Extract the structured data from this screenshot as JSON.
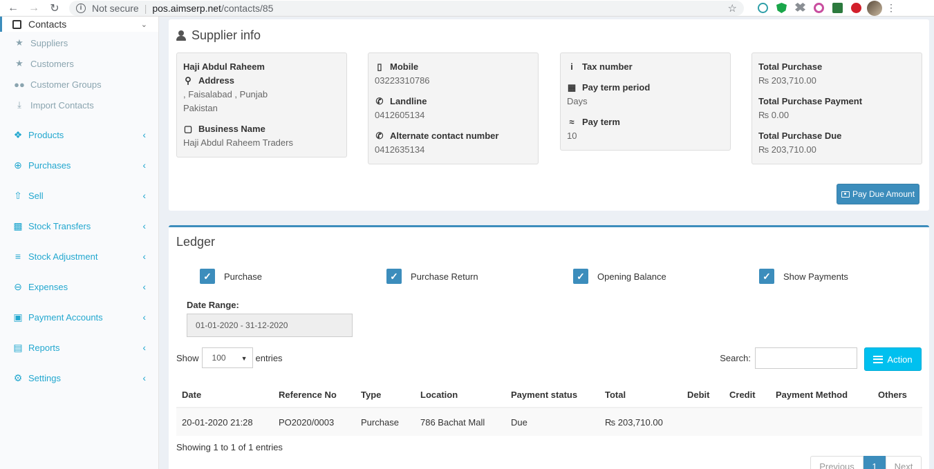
{
  "browser": {
    "security": "Not secure",
    "url_host": "pos.aimserp.net",
    "url_path": "/contacts/85"
  },
  "sidebar": {
    "header": "Contacts",
    "sub_items": [
      {
        "label": "Suppliers",
        "icon": "star-icon"
      },
      {
        "label": "Customers",
        "icon": "star-icon"
      },
      {
        "label": "Customer Groups",
        "icon": "users-icon"
      },
      {
        "label": "Import Contacts",
        "icon": "download-icon"
      }
    ],
    "items": [
      {
        "label": "Products",
        "icon": "cubes-icon"
      },
      {
        "label": "Purchases",
        "icon": "plus-circle-icon"
      },
      {
        "label": "Sell",
        "icon": "arrow-circle-up-icon"
      },
      {
        "label": "Stock Transfers",
        "icon": "truck-icon"
      },
      {
        "label": "Stock Adjustment",
        "icon": "database-icon"
      },
      {
        "label": "Expenses",
        "icon": "minus-circle-icon"
      },
      {
        "label": "Payment Accounts",
        "icon": "money-icon"
      },
      {
        "label": "Reports",
        "icon": "bar-chart-icon"
      },
      {
        "label": "Settings",
        "icon": "cog-icon"
      }
    ]
  },
  "supplier": {
    "title": "Supplier info",
    "name": "Haji Abdul Raheem",
    "address_label": "Address",
    "address_line1": ", Faisalabad , Punjab",
    "address_line2": "Pakistan",
    "business_label": "Business Name",
    "business_name": "Haji Abdul Raheem Traders",
    "mobile_label": "Mobile",
    "mobile": "03223310786",
    "landline_label": "Landline",
    "landline": "0412605134",
    "alt_label": "Alternate contact number",
    "alt": "0412635134",
    "tax_label": "Tax number",
    "pay_term_period_label": "Pay term period",
    "pay_term_period": "Days",
    "pay_term_label": "Pay term",
    "pay_term": "10",
    "total_purchase_label": "Total Purchase",
    "total_purchase": "₨ 203,710.00",
    "total_payment_label": "Total Purchase Payment",
    "total_payment": "₨ 0.00",
    "total_due_label": "Total Purchase Due",
    "total_due": "₨ 203,710.00",
    "pay_due_button": "Pay Due Amount"
  },
  "ledger": {
    "title": "Ledger",
    "filters": [
      "Purchase",
      "Purchase Return",
      "Opening Balance",
      "Show Payments"
    ],
    "date_range_label": "Date Range:",
    "date_range": "01-01-2020 - 31-12-2020",
    "show_label": "Show",
    "entries_value": "100",
    "entries_label": "entries",
    "search_label": "Search:",
    "action_button": "Action",
    "columns": [
      "Date",
      "Reference No",
      "Type",
      "Location",
      "Payment status",
      "Total",
      "Debit",
      "Credit",
      "Payment Method",
      "Others"
    ],
    "rows": [
      [
        "20-01-2020 21:28",
        "PO2020/0003",
        "Purchase",
        "786 Bachat Mall",
        "Due",
        "₨ 203,710.00",
        "",
        "",
        "",
        ""
      ]
    ],
    "showing": "Showing 1 to 1 of 1 entries",
    "pager": {
      "prev": "Previous",
      "current": "1",
      "next": "Next"
    }
  },
  "colors": {
    "primary": "#3c8dbc",
    "info": "#00c0ef",
    "sidebar_link": "#22a7cf"
  }
}
